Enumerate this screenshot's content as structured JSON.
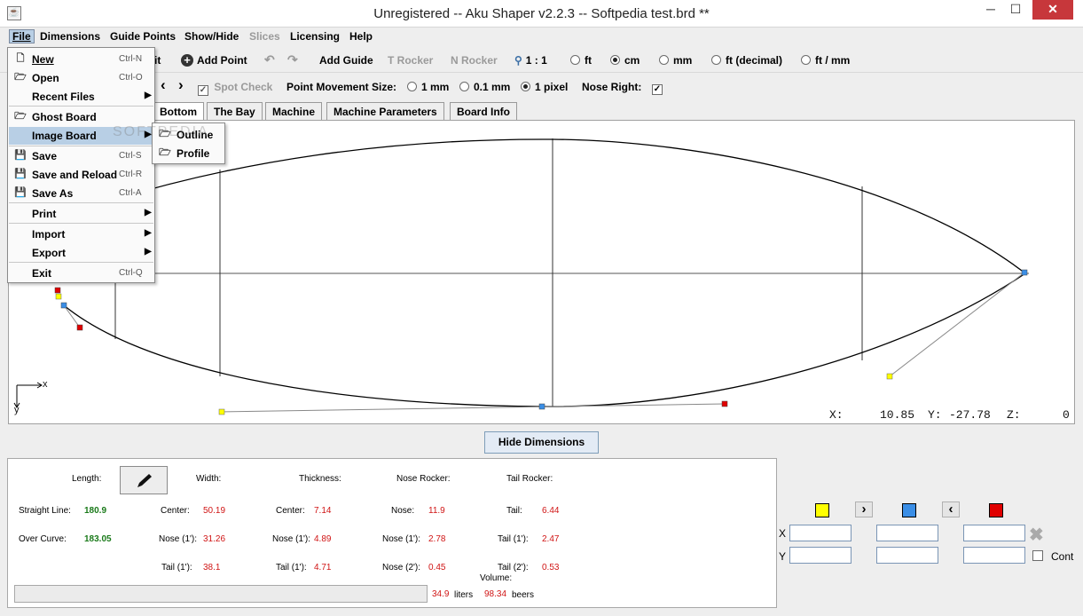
{
  "window": {
    "title": "Unregistered -- Aku Shaper v2.2.3  --  Softpedia test.brd  **",
    "minimize": "─",
    "maximize": "☐",
    "close": "✕"
  },
  "menubar": [
    "File",
    "Dimensions",
    "Guide Points",
    "Show/Hide",
    "Slices",
    "Licensing",
    "Help"
  ],
  "toolbar1": {
    "partial": "it",
    "add_point": "Add Point",
    "add_guide": "Add Guide",
    "t_rocker": "T Rocker",
    "n_rocker": "N Rocker",
    "scale": "1 : 1",
    "units": [
      "ft",
      "cm",
      "mm",
      "ft (decimal)",
      "ft / mm"
    ],
    "selected_unit": "cm"
  },
  "toolbar2": {
    "spot_check": "Spot Check",
    "point_movement_label": "Point Movement Size:",
    "movement_options": [
      "1 mm",
      "0.1 mm",
      "1 pixel"
    ],
    "selected_movement": "1 pixel",
    "nose_right_label": "Nose Right:",
    "nose_right_checked": true
  },
  "tabs": [
    "Bottom",
    "The Bay",
    "Machine",
    "Machine Parameters",
    "Board Info"
  ],
  "canvas": {
    "axis_x": "x",
    "axis_y": "y",
    "coord_x_label": "X:",
    "coord_x": "10.85",
    "coord_y_label": "Y:",
    "coord_y": "-27.78",
    "coord_z_label": "Z:",
    "coord_z": "0",
    "watermark": "SOFTPEDIA"
  },
  "hide_dimensions": "Hide Dimensions",
  "dimensions": {
    "length_label": "Length:",
    "width_label": "Width:",
    "thickness_label": "Thickness:",
    "nose_rocker_label": "Nose Rocker:",
    "tail_rocker_label": "Tail Rocker:",
    "straight_line_label": "Straight Line:",
    "straight_line": "180.9",
    "over_curve_label": "Over Curve:",
    "over_curve": "183.05",
    "width_center_label": "Center:",
    "width_center": "50.19",
    "width_nose1_label": "Nose (1'):",
    "width_nose1": "31.26",
    "width_tail1_label": "Tail (1'):",
    "width_tail1": "38.1",
    "thick_center_label": "Center:",
    "thick_center": "7.14",
    "thick_nose1_label": "Nose (1'):",
    "thick_nose1": "4.89",
    "thick_tail1_label": "Tail (1'):",
    "thick_tail1": "4.71",
    "nose_label": "Nose:",
    "nose": "11.9",
    "nose1_label": "Nose (1'):",
    "nose1": "2.78",
    "nose2_label": "Nose (2'):",
    "nose2": "0.45",
    "tail_label": "Tail:",
    "tail": "6.44",
    "tail1_label": "Tail (1'):",
    "tail1": "2.47",
    "tail2_label": "Tail (2'):",
    "tail2": "0.53",
    "volume_label": "Volume:",
    "volume_liters": "34.9",
    "liters_label": "liters",
    "volume_beers": "98.34",
    "beers_label": "beers"
  },
  "controls": {
    "colors": {
      "yellow": "#ffff00",
      "blue": "#3a8ee6",
      "red": "#e00000"
    },
    "x_label": "X",
    "y_label": "Y",
    "cont_label": "Cont"
  },
  "file_menu": {
    "items": [
      {
        "label": "New",
        "shortcut": "Ctrl-N",
        "icon": "new-file-icon"
      },
      {
        "label": "Open",
        "shortcut": "Ctrl-O",
        "icon": "open-folder-icon"
      },
      {
        "label": "Recent Files",
        "shortcut": "",
        "icon": ""
      },
      {
        "label": "Ghost Board",
        "shortcut": "",
        "icon": "open-folder-icon"
      },
      {
        "label": "Image Board",
        "shortcut": "",
        "icon": ""
      },
      {
        "label": "Save",
        "shortcut": "Ctrl-S",
        "icon": "save-icon"
      },
      {
        "label": "Save and Reload",
        "shortcut": "Ctrl-R",
        "icon": "save-icon"
      },
      {
        "label": "Save As",
        "shortcut": "Ctrl-A",
        "icon": "save-as-icon"
      },
      {
        "label": "Print",
        "shortcut": "",
        "icon": ""
      },
      {
        "label": "Import",
        "shortcut": "",
        "icon": ""
      },
      {
        "label": "Export",
        "shortcut": "",
        "icon": ""
      },
      {
        "label": "Exit",
        "shortcut": "Ctrl-Q",
        "icon": ""
      }
    ],
    "submenu": [
      "Outline",
      "Profile"
    ]
  }
}
